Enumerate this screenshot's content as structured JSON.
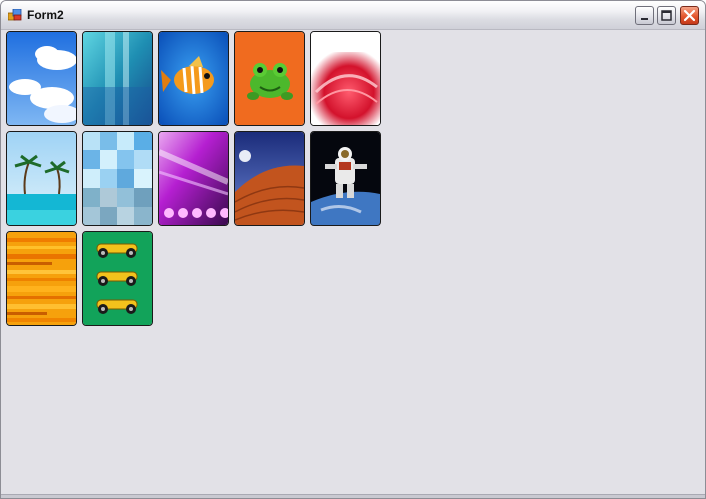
{
  "window": {
    "title": "Form2",
    "icon": "form-app-icon",
    "controls": [
      "minimize-icon",
      "maximize-icon",
      "close-icon"
    ]
  },
  "images": [
    {
      "name": "tile-sky-clouds",
      "row": 1,
      "col": 1,
      "desc_icon": "clouds-picture"
    },
    {
      "name": "tile-aqua-abstract",
      "row": 1,
      "col": 2,
      "desc_icon": "aqua-abstract-picture"
    },
    {
      "name": "tile-tropical-fish",
      "row": 1,
      "col": 3,
      "desc_icon": "fish-picture"
    },
    {
      "name": "tile-green-frog",
      "row": 1,
      "col": 4,
      "desc_icon": "frog-picture"
    },
    {
      "name": "tile-red-swirl",
      "row": 1,
      "col": 5,
      "desc_icon": "red-swirl-picture"
    },
    {
      "name": "tile-palm-beach",
      "row": 2,
      "col": 1,
      "desc_icon": "beach-picture"
    },
    {
      "name": "tile-blue-mosaic",
      "row": 2,
      "col": 2,
      "desc_icon": "mosaic-picture"
    },
    {
      "name": "tile-purple-lights",
      "row": 2,
      "col": 3,
      "desc_icon": "purple-lights-picture"
    },
    {
      "name": "tile-desert-moon",
      "row": 2,
      "col": 4,
      "desc_icon": "desert-picture"
    },
    {
      "name": "tile-astronaut",
      "row": 2,
      "col": 5,
      "desc_icon": "astronaut-picture"
    },
    {
      "name": "tile-orange-stripes",
      "row": 3,
      "col": 1,
      "desc_icon": "stripes-picture"
    },
    {
      "name": "tile-race-cars",
      "row": 3,
      "col": 2,
      "desc_icon": "cars-picture"
    }
  ],
  "colors": {
    "client_bg": "#e2e1e7",
    "titlebar_top": "#ffffff",
    "titlebar_bottom": "#cfd0d8",
    "close_button": "#e4572e"
  }
}
